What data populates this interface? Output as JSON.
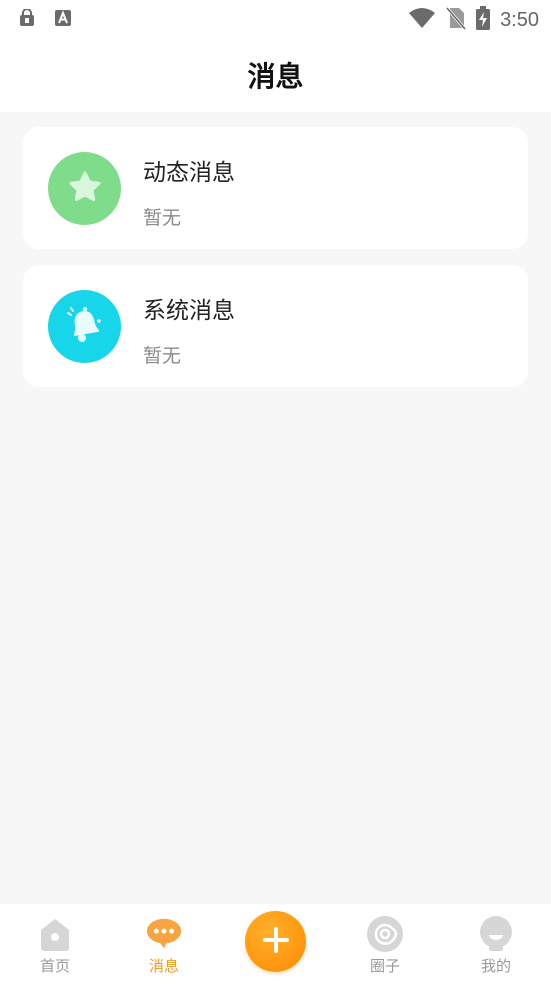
{
  "status_bar": {
    "time": "3:50"
  },
  "header": {
    "title": "消息"
  },
  "messages": [
    {
      "title": "动态消息",
      "subtitle": "暂无",
      "icon": "star-icon",
      "color": "#7fdc8a"
    },
    {
      "title": "系统消息",
      "subtitle": "暂无",
      "icon": "bell-icon",
      "color": "#17d6e9"
    }
  ],
  "tabbar": {
    "items": [
      {
        "label": "首页",
        "icon": "home-icon",
        "active": false
      },
      {
        "label": "消息",
        "icon": "chat-icon",
        "active": true
      },
      {
        "label": "",
        "icon": "plus-icon",
        "active": false
      },
      {
        "label": "圈子",
        "icon": "circle-icon",
        "active": false
      },
      {
        "label": "我的",
        "icon": "profile-icon",
        "active": false
      }
    ]
  },
  "colors": {
    "accent": "#f39a1a",
    "inactive": "#cccccc"
  }
}
